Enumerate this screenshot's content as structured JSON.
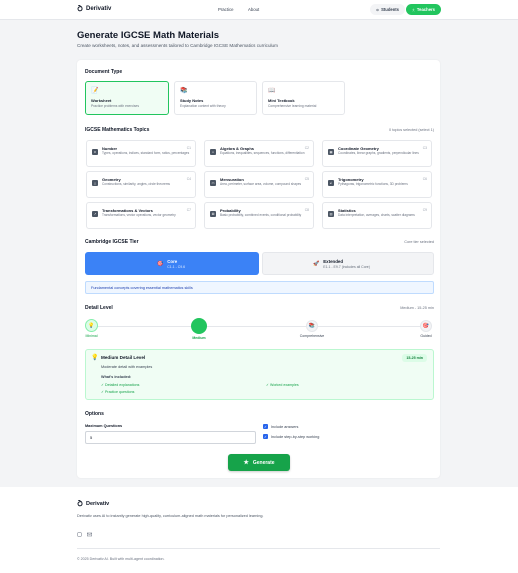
{
  "header": {
    "brand": "Derivativ",
    "nav": [
      "Practice",
      "About"
    ],
    "students_label": "Students",
    "teachers_label": "Teachers"
  },
  "page": {
    "title": "Generate IGCSE Math Materials",
    "subtitle": "Create worksheets, notes, and assessments tailored to Cambridge IGCSE Mathematics curriculum"
  },
  "document_type": {
    "heading": "Document Type",
    "options": [
      {
        "title": "Worksheet",
        "desc": "Practice problems with exercises",
        "icon": "📝"
      },
      {
        "title": "Study Notes",
        "desc": "Explanation content with theory",
        "icon": "📚"
      },
      {
        "title": "Mini Textbook",
        "desc": "Comprehensive learning material",
        "icon": "📖"
      }
    ]
  },
  "topics": {
    "heading": "IGCSE Mathematics Topics",
    "selected_text": "0 topics selected (select 1)",
    "items": [
      {
        "title": "Number",
        "desc": "Types, operations, indices, standard form, ratios, percentages",
        "code": "C1",
        "icon": "#"
      },
      {
        "title": "Algebra & Graphs",
        "desc": "Equations, inequalities, sequences, functions, differentiation",
        "code": "C2",
        "icon": "x"
      },
      {
        "title": "Coordinate Geometry",
        "desc": "Coordinates, linear graphs, gradients, perpendicular lines",
        "code": "C3",
        "icon": "▦"
      },
      {
        "title": "Geometry",
        "desc": "Constructions, similarity, angles, circle theorems",
        "code": "C4",
        "icon": "△"
      },
      {
        "title": "Mensuration",
        "desc": "Area, perimeter, surface area, volume, compound shapes",
        "code": "C5",
        "icon": "▭"
      },
      {
        "title": "Trigonometry",
        "desc": "Pythagoras, trigonometric functions, 3D problems",
        "code": "C6",
        "icon": "∠"
      },
      {
        "title": "Transformations & Vectors",
        "desc": "Transformations, vector operations, vector geometry",
        "code": "C7",
        "icon": "↗"
      },
      {
        "title": "Probability",
        "desc": "Basic probability, combined events, conditional probability",
        "code": "C8",
        "icon": "⚄"
      },
      {
        "title": "Statistics",
        "desc": "Data interpretation, averages, charts, scatter diagrams",
        "code": "C9",
        "icon": "▥"
      }
    ]
  },
  "tier": {
    "heading": "Cambridge IGCSE Tier",
    "selected_text": "Core tier selected",
    "options": [
      {
        "name": "Core",
        "range": "C1.1 - C9.6",
        "icon": "🎯"
      },
      {
        "name": "Extended",
        "range": "E1.1 - E9.7 (includes all Core)",
        "icon": "🚀"
      }
    ],
    "info": "Fundamental concepts covering essential mathematics skills"
  },
  "detail": {
    "heading": "Detail Level",
    "selected_text": "Medium - 15-25 min",
    "levels": [
      "Minimal",
      "Medium",
      "Comprehensive",
      "Guided"
    ],
    "selected_index": 1,
    "card": {
      "title": "Medium Detail Level",
      "badge": "15-25 min",
      "desc": "Moderate detail with examples",
      "included_label": "What's included:",
      "items": [
        "Detailed explanations",
        "Worked examples",
        "Practice questions"
      ]
    }
  },
  "options": {
    "heading": "Options",
    "max_questions_label": "Maximum Questions",
    "max_questions_value": "5",
    "include_answers": "Include answers",
    "include_working": "Include step-by-step working"
  },
  "generate_label": "Generate",
  "footer": {
    "brand": "Derivativ",
    "desc": "Derivativ uses AI to instantly generate high-quality, curriculum-aligned math materials for personalized learning.",
    "copyright": "© 2025 Derivativ AI. Built with multi-agent coordination."
  },
  "colors": {
    "accent": "#22c55e",
    "core_tier": "#3b82f6"
  }
}
